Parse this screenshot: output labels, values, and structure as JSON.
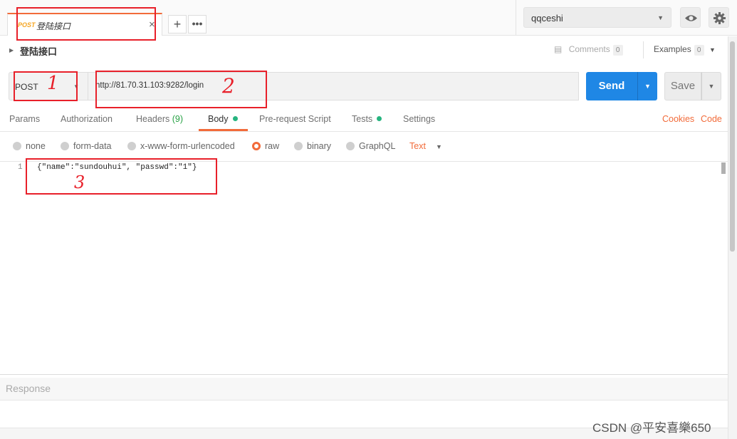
{
  "tabs": [
    {
      "method": "POST",
      "title": "登陆接口",
      "close": "×"
    }
  ],
  "tab_actions": {
    "add": "+",
    "more": "•••"
  },
  "environment": {
    "selected": "qqceshi"
  },
  "request": {
    "name": "登陆接口",
    "method": "POST",
    "url": "http://81.70.31.103:9282/login",
    "comments_label": "Comments",
    "comments_count": "0",
    "examples_label": "Examples",
    "examples_count": "0",
    "send_label": "Send",
    "save_label": "Save"
  },
  "request_tabs": {
    "params": "Params",
    "authorization": "Authorization",
    "headers": "Headers",
    "headers_count": "(9)",
    "body": "Body",
    "prerequest": "Pre-request Script",
    "tests": "Tests",
    "settings": "Settings",
    "cookies": "Cookies",
    "code": "Code"
  },
  "body_types": {
    "none": "none",
    "form_data": "form-data",
    "urlencoded": "x-www-form-urlencoded",
    "raw": "raw",
    "binary": "binary",
    "graphql": "GraphQL",
    "selected": "raw",
    "format": "Text"
  },
  "editor": {
    "line_number": "1",
    "code": "{\"name\":\"sundouhui\", \"passwd\":\"1\"}"
  },
  "response": {
    "label": "Response"
  },
  "watermark": "CSDN @平安喜樂650",
  "annotations": {
    "one": "1",
    "two": "2",
    "three": "3"
  },
  "colors": {
    "accent": "#f26b3a",
    "send": "#1f87e5",
    "annotation": "#e8202a",
    "dot": "#26b47f"
  }
}
